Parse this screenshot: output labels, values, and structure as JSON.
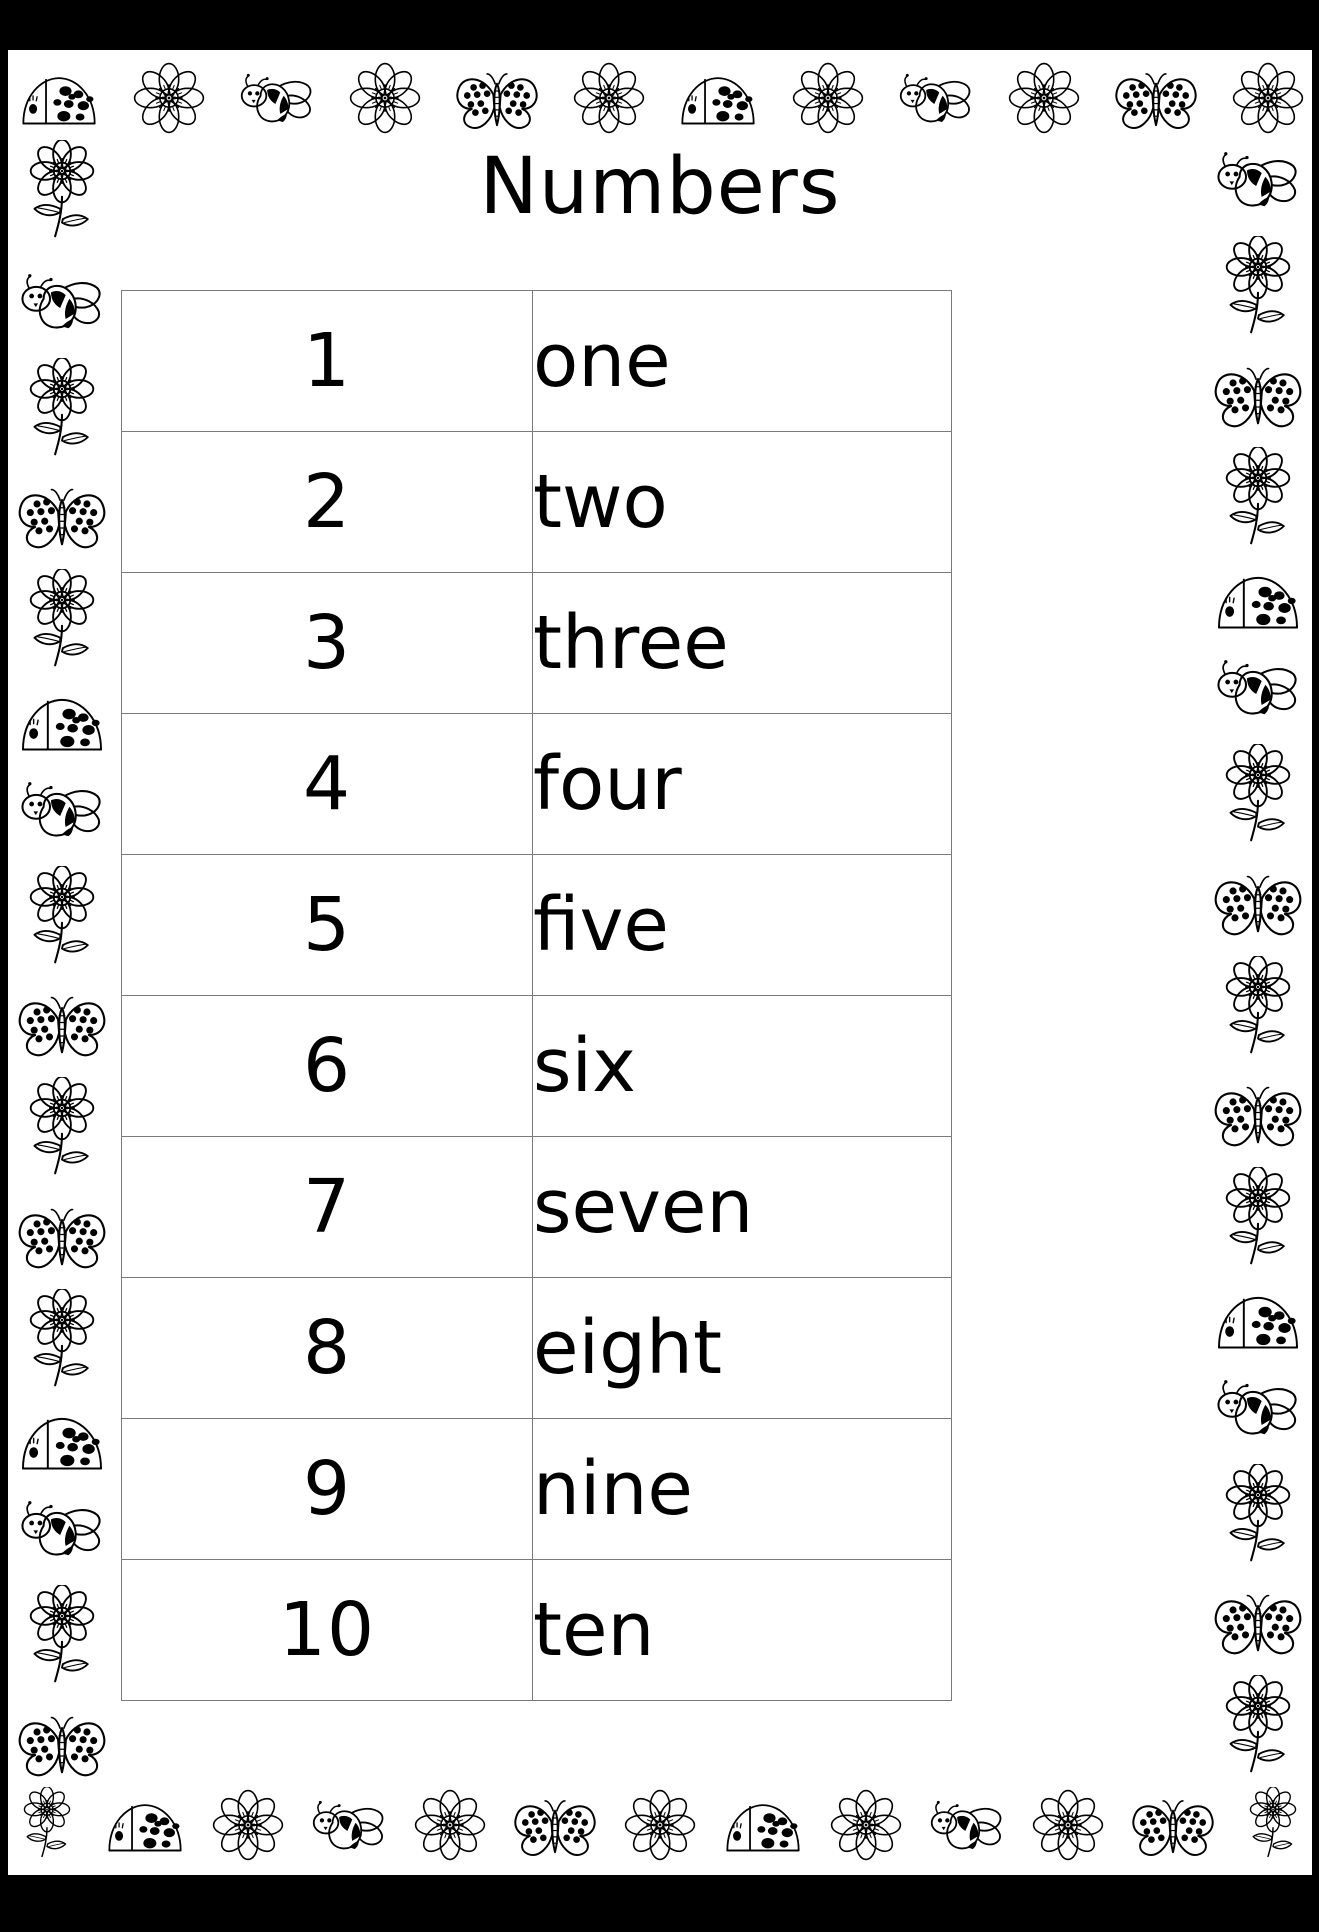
{
  "page": {
    "title": "Numbers",
    "frame_color": "#000000",
    "paper_color": "#ffffff",
    "ink_color": "#000000",
    "table_border_color": "#7a7a7a"
  },
  "table": {
    "columns": [
      "digit",
      "word"
    ],
    "rows": [
      {
        "digit": "1",
        "word": "one"
      },
      {
        "digit": "2",
        "word": "two"
      },
      {
        "digit": "3",
        "word": "three"
      },
      {
        "digit": "4",
        "word": "four"
      },
      {
        "digit": "5",
        "word": "five"
      },
      {
        "digit": "6",
        "word": "six"
      },
      {
        "digit": "7",
        "word": "seven"
      },
      {
        "digit": "8",
        "word": "eight"
      },
      {
        "digit": "9",
        "word": "nine"
      },
      {
        "digit": "10",
        "word": "ten"
      }
    ]
  },
  "decorations": {
    "top": [
      "ladybug-icon",
      "flower-icon",
      "bee-icon",
      "flower-icon",
      "butterfly-icon",
      "flower-icon",
      "ladybug-icon",
      "flower-icon",
      "bee-icon",
      "flower-icon",
      "butterfly-icon",
      "flower-icon"
    ],
    "bottom": [
      "flower-stem-icon",
      "ladybug-icon",
      "flower-icon",
      "bee-icon",
      "flower-icon",
      "butterfly-icon",
      "flower-icon",
      "ladybug-icon",
      "flower-icon",
      "bee-icon",
      "flower-icon",
      "butterfly-icon",
      "flower-stem-icon"
    ],
    "left": [
      "flower-stem-icon",
      "bee-icon",
      "flower-stem-icon",
      "butterfly-icon",
      "flower-stem-icon",
      "ladybug-icon",
      "bee-icon",
      "flower-stem-icon",
      "butterfly-icon",
      "flower-stem-icon",
      "butterfly-icon",
      "flower-stem-icon",
      "ladybug-icon",
      "bee-icon",
      "flower-stem-icon",
      "butterfly-icon"
    ],
    "right": [
      "bee-icon",
      "flower-stem-icon",
      "butterfly-icon",
      "flower-stem-icon",
      "ladybug-icon",
      "bee-icon",
      "flower-stem-icon",
      "butterfly-icon",
      "flower-stem-icon",
      "butterfly-icon",
      "flower-stem-icon",
      "ladybug-icon",
      "bee-icon",
      "flower-stem-icon",
      "butterfly-icon",
      "flower-stem-icon"
    ]
  }
}
